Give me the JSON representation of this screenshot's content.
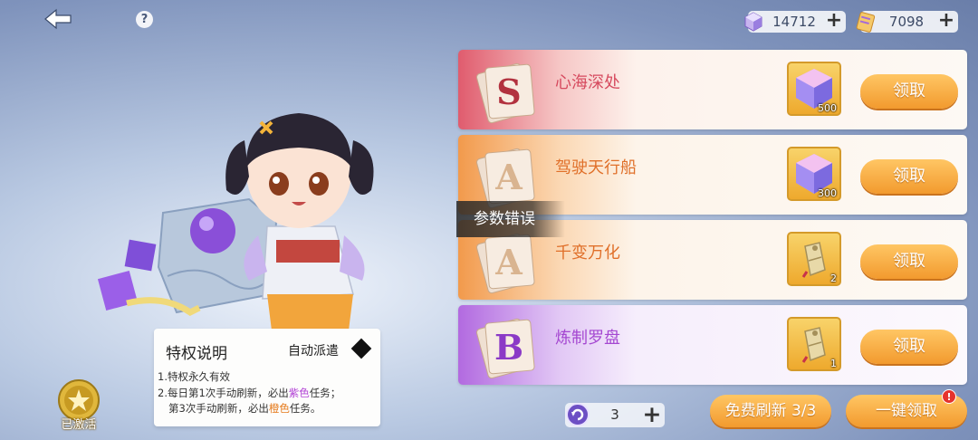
{
  "header": {
    "back_icon": "back-arrow-icon",
    "help_icon": "question-icon",
    "help_glyph": "?",
    "gems": {
      "icon": "gem-currency-icon",
      "value": "14712",
      "plus": "+"
    },
    "tickets": {
      "icon": "ticket-currency-icon",
      "value": "7098",
      "plus": "+"
    }
  },
  "privilege": {
    "title": "特权说明",
    "auto_dispatch_label": "自动派遣",
    "line1": "1.特权永久有效",
    "line2_a": "2.每日第1次手动刷新，必出",
    "line2_purple": "紫色",
    "line2_b": "任务；",
    "line3_a": "第3次手动刷新，必出",
    "line3_orange": "橙色",
    "line3_b": "任务。",
    "activated_badge": "已激活"
  },
  "tasks": [
    {
      "grade": "S",
      "name": "心海深处",
      "reward_icon": "crystal-cube-icon",
      "reward_count": "500",
      "claim": "领取",
      "theme": "red"
    },
    {
      "grade": "A",
      "name": "驾驶天行船",
      "reward_icon": "crystal-cube-icon",
      "reward_count": "300",
      "claim": "领取",
      "theme": "orange"
    },
    {
      "grade": "A",
      "name": "千变万化",
      "reward_icon": "scroll-token-icon",
      "reward_count": "2",
      "claim": "领取",
      "theme": "orange"
    },
    {
      "grade": "B",
      "name": "炼制罗盘",
      "reward_icon": "scroll-token-icon",
      "reward_count": "1",
      "claim": "领取",
      "theme": "purple"
    }
  ],
  "toast": "参数错误",
  "footer": {
    "refresh_item_icon": "refresh-token-icon",
    "refresh_count": "3",
    "refresh_plus": "+",
    "free_refresh": "免费刷新 3/3",
    "claim_all": "一键领取",
    "notice": "!"
  },
  "colors": {
    "claim_button": "#f29a2e",
    "red_theme": "#e05c6e",
    "orange_theme": "#f29a4c",
    "purple_theme": "#b26ae0"
  }
}
